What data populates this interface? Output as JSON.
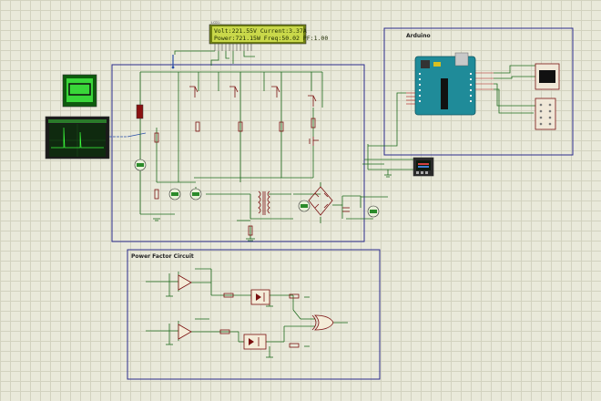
{
  "lcd": {
    "line1": "Volt:221.55V Current:3.37A",
    "line2": "Power:721.15W Freq:50.02 PF:1.00"
  },
  "sections": {
    "arduino": "Arduino",
    "power_factor": "Power Factor Circuit"
  },
  "colors": {
    "sheet": "#e9e9da",
    "grid": "#d2d2bf",
    "frame": "#2b2b8c",
    "wire": "#1d6b1d",
    "lcd": "#c9d84a",
    "arduino_board": "#1f8b99"
  }
}
